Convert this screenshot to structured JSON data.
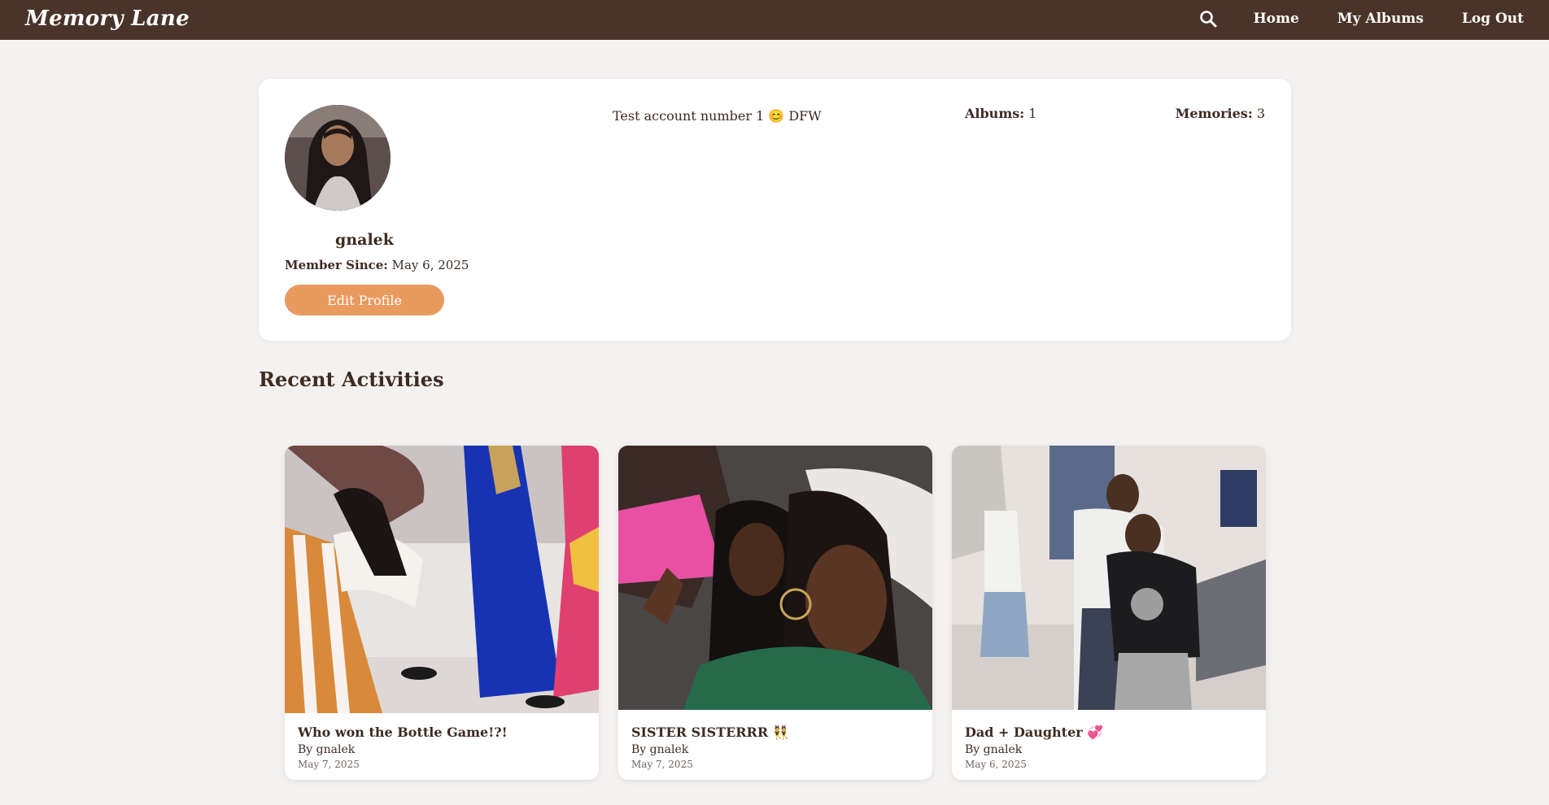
{
  "nav": {
    "brand": "Memory Lane",
    "links": [
      "Home",
      "My Albums",
      "Log Out"
    ]
  },
  "profile": {
    "username": "gnalek",
    "member_since_label": "Member Since:",
    "member_since_value": "May 6, 2025",
    "edit_button": "Edit Profile",
    "bio": "Test account number 1 😊 DFW",
    "albums_label": "Albums:",
    "albums_value": "1",
    "memories_label": "Memories:",
    "memories_value": "3"
  },
  "section": {
    "title": "Recent Activities"
  },
  "memories": [
    {
      "title": "Who won the Bottle Game!?!",
      "author": "By gnalek",
      "date": "May 7, 2025"
    },
    {
      "title": "SISTER SISTERRR 👯",
      "author": "By gnalek",
      "date": "May 7, 2025"
    },
    {
      "title": "Dad + Daughter 💞",
      "author": "By gnalek",
      "date": "May 6, 2025"
    }
  ],
  "colors": {
    "navbar": "#4a3429",
    "accent": "#e99b5f",
    "background": "#f4f2f1"
  }
}
